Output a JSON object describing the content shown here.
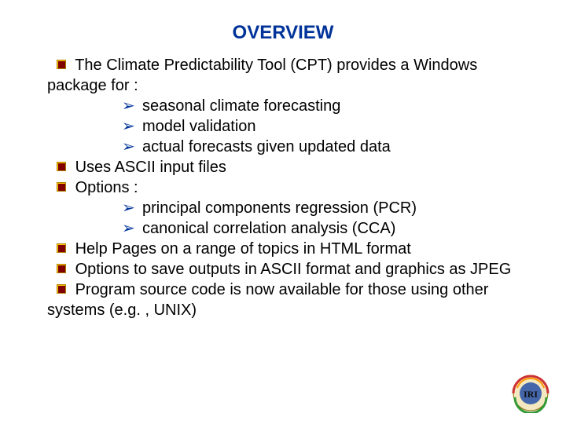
{
  "title": "OVERVIEW",
  "items": {
    "i0": "The Climate Predictability Tool (CPT) provides a Windows package for :",
    "i0s0": "seasonal climate forecasting",
    "i0s1": "model validation",
    "i0s2": "actual forecasts given updated data",
    "i1": "Uses ASCII input files",
    "i2": "Options :",
    "i2s0": "principal components regression (PCR)",
    "i2s1": "canonical correlation analysis (CCA)",
    "i3": "Help Pages on a range of topics in HTML format",
    "i4": "Options to save outputs in ASCII format and graphics as JPEG",
    "i5": "Program source code is now available for those using other systems (e.g. , UNIX)"
  },
  "logo_label": "IRI"
}
